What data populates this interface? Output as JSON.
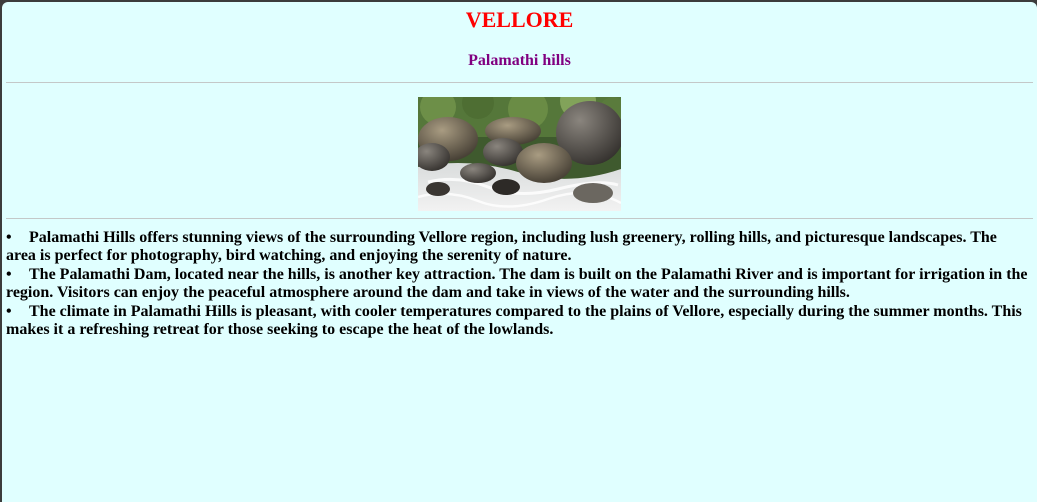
{
  "page": {
    "title": "VELLORE",
    "subtitle": "Palamathi hills",
    "image_alt": "Rocks and a rushing stream at Palamathi Hills",
    "bullet_glyph": "•",
    "facts": [
      "Palamathi Hills offers stunning views of the surrounding Vellore region, including lush greenery, rolling hills, and picturesque landscapes. The area is perfect for photography, bird watching, and enjoying the serenity of nature.",
      "The Palamathi Dam, located near the hills, is another key attraction. The dam is built on the Palamathi River and is important for irrigation in the region. Visitors can enjoy the peaceful atmosphere around the dam and take in views of the water and the surrounding hills.",
      "The climate in Palamathi Hills is pleasant, with cooler temperatures compared to the plains of Vellore, especially during the summer months. This makes it a refreshing retreat for those seeking to escape the heat of the lowlands."
    ]
  },
  "colors": {
    "background": "#e0ffff",
    "title": "#ff0000",
    "subtitle": "#800080",
    "text": "#000000"
  }
}
